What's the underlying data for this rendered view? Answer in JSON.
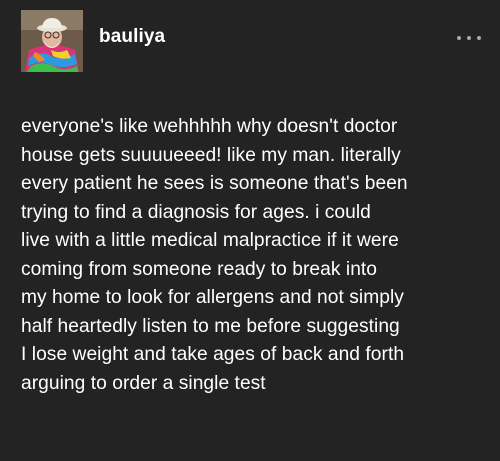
{
  "post": {
    "username": "bauliya",
    "more_icon": "ellipsis-icon",
    "avatar_icon": "user-avatar",
    "body_text": "everyone's like wehhhhh why doesn't doctor\nhouse gets suuuueeed! like my man. literally\nevery patient he sees is someone that's been\ntrying to find a diagnosis for ages. i could\nlive with a little medical malpractice if it were\ncoming from someone ready to break into\nmy home to look for allergens and not simply\nhalf heartedly listen to me before suggesting\nI lose weight and take ages of back and forth\narguing to order a single test"
  },
  "colors": {
    "background": "#232323",
    "text": "#ffffff",
    "icon_muted": "#a8a8a8"
  }
}
